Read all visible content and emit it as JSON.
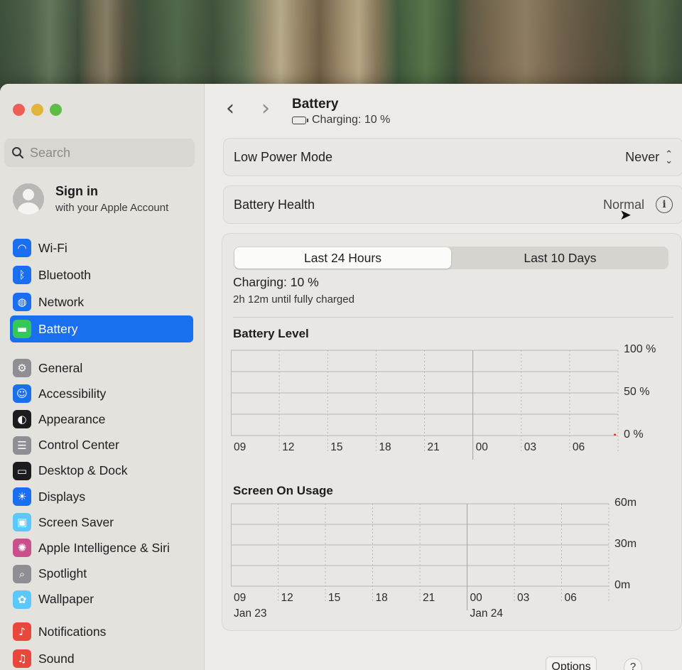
{
  "window": {
    "title": "Battery",
    "subtitle": "Charging: 10 %"
  },
  "search": {
    "placeholder": "Search"
  },
  "account": {
    "title": "Sign in",
    "subtitle": "with your Apple Account"
  },
  "sidebar": {
    "group1": [
      {
        "label": "Wi-Fi",
        "icon": "wifi-icon",
        "color": "#1a6ef0"
      },
      {
        "label": "Bluetooth",
        "icon": "bluetooth-icon",
        "color": "#1a6ef0"
      },
      {
        "label": "Network",
        "icon": "globe-icon",
        "color": "#1a6ef0"
      },
      {
        "label": "Battery",
        "icon": "battery-icon",
        "color": "#34c759",
        "active": true
      }
    ],
    "group2": [
      {
        "label": "General",
        "icon": "gear-icon",
        "color": "#8e8e93"
      },
      {
        "label": "Accessibility",
        "icon": "accessibility-icon",
        "color": "#1a6ef0"
      },
      {
        "label": "Appearance",
        "icon": "appearance-icon",
        "color": "#1c1c1e"
      },
      {
        "label": "Control Center",
        "icon": "control-center-icon",
        "color": "#8e8e93"
      },
      {
        "label": "Desktop & Dock",
        "icon": "dock-icon",
        "color": "#1c1c1e"
      },
      {
        "label": "Displays",
        "icon": "sun-icon",
        "color": "#1a6ef0"
      },
      {
        "label": "Screen Saver",
        "icon": "screen-saver-icon",
        "color": "#5ac8fa"
      },
      {
        "label": "Apple Intelligence & Siri",
        "icon": "siri-icon",
        "color": "#c94f8d"
      },
      {
        "label": "Spotlight",
        "icon": "magnifier-icon",
        "color": "#8e8e93"
      },
      {
        "label": "Wallpaper",
        "icon": "flower-icon",
        "color": "#5ac8fa"
      }
    ],
    "group3": [
      {
        "label": "Notifications",
        "icon": "bell-icon",
        "color": "#e8473c"
      },
      {
        "label": "Sound",
        "icon": "speaker-icon",
        "color": "#e8473c"
      }
    ]
  },
  "settings": {
    "low_power": {
      "label": "Low Power Mode",
      "value": "Never"
    },
    "health": {
      "label": "Battery Health",
      "value": "Normal"
    }
  },
  "segments": {
    "tab1": "Last 24 Hours",
    "tab2": "Last 10 Days",
    "selected": "Last 24 Hours"
  },
  "charging": {
    "title": "Charging: 10 %",
    "detail": "2h 12m until fully charged"
  },
  "chart_data": [
    {
      "type": "bar",
      "title": "Battery Level",
      "categories": [
        "09",
        "12",
        "15",
        "18",
        "21",
        "00",
        "03",
        "06"
      ],
      "y_ticks": [
        "100 %",
        "50 %",
        "0 %"
      ],
      "ylim": [
        0,
        100
      ],
      "series": [
        {
          "values": [
            0,
            0,
            0,
            0,
            0,
            0,
            0,
            2
          ]
        }
      ],
      "grid": true
    },
    {
      "type": "bar",
      "title": "Screen On Usage",
      "categories": [
        "09",
        "12",
        "15",
        "18",
        "21",
        "00",
        "03",
        "06"
      ],
      "date_labels": {
        "first": "Jan 23",
        "midnight": "Jan 24"
      },
      "y_ticks": [
        "60m",
        "30m",
        "0m"
      ],
      "ylim": [
        0,
        60
      ],
      "series": [
        {
          "values": [
            0,
            0,
            0,
            0,
            0,
            0,
            0,
            0
          ]
        }
      ],
      "grid": true
    }
  ],
  "footer": {
    "options_label": "Options",
    "help_label": "?"
  }
}
